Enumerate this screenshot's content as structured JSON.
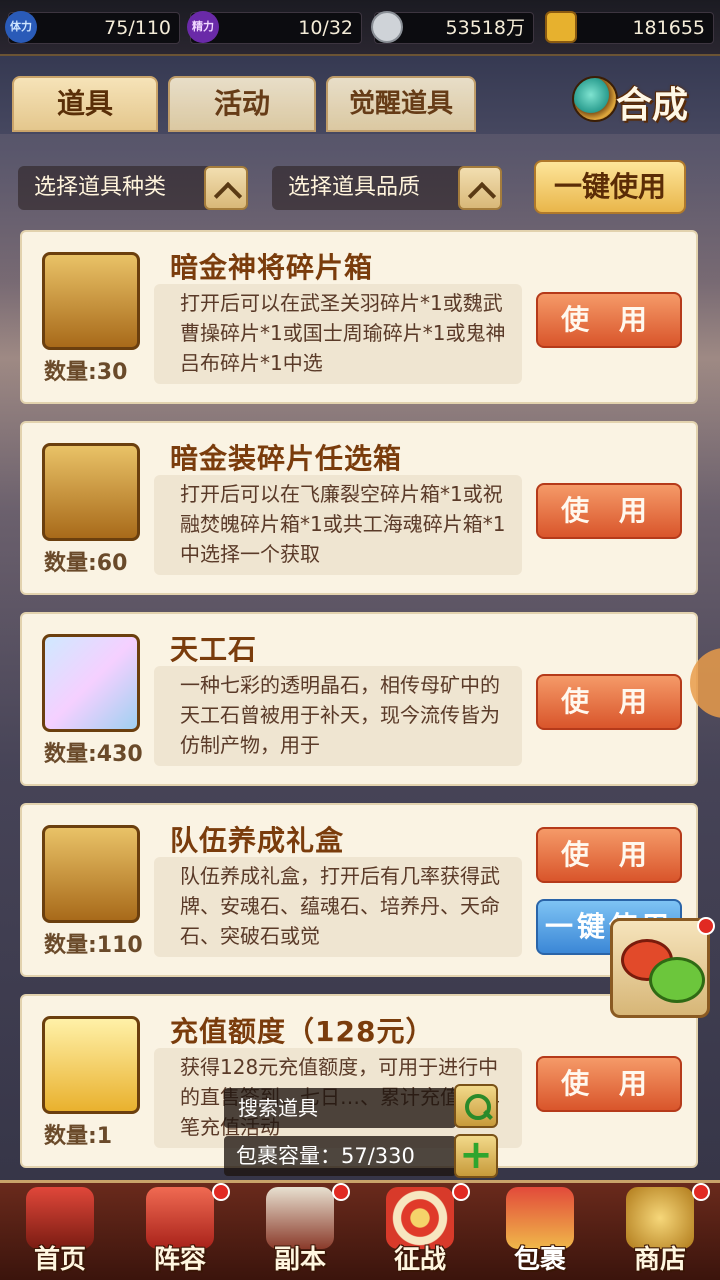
{
  "resources": {
    "stamina_icon": "体力",
    "stamina": "75/110",
    "energy_icon": "精力",
    "energy": "10/32",
    "silver": "53518万",
    "gold": "181655"
  },
  "tabs": [
    {
      "label": "道具"
    },
    {
      "label": "活动"
    },
    {
      "label": "觉醒道具"
    }
  ],
  "craft_label": "合成",
  "filters": {
    "type_label": "选择道具种类",
    "quality_label": "选择道具品质"
  },
  "use_all_label": "一键使用",
  "items": [
    {
      "title": "暗金神将碎片箱",
      "desc": "打开后可以在武圣关羽碎片*1或魏武曹操碎片*1或国士周瑜碎片*1或鬼神吕布碎片*1中选",
      "qty": "数量:30",
      "use_label": "使 用"
    },
    {
      "title": "暗金装碎片任选箱",
      "desc": "打开后可以在飞廉裂空碎片箱*1或祝融焚魄碎片箱*1或共工海魂碎片箱*1中选择一个获取",
      "qty": "数量:60",
      "use_label": "使 用"
    },
    {
      "title": "天工石",
      "desc": "一种七彩的透明晶石，相传母矿中的天工石曾被用于补天，现今流传皆为仿制产物，用于",
      "qty": "数量:430",
      "use_label": "使 用"
    },
    {
      "title": "队伍养成礼盒",
      "desc": "队伍养成礼盒，打开后有几率获得武牌、安魂石、蕴魂石、培养丹、天命石、突破石或觉",
      "qty": "数量:110",
      "use_label": "使 用",
      "use_all_label": "一键使用"
    },
    {
      "title": "充值额度（128元）",
      "desc": "获得128元充值额度，可用于进行中的直售签到、七日…、累计充值、单笔充值活动",
      "qty": "数量:1",
      "use_label": "使 用"
    }
  ],
  "search_label": "搜索道具",
  "capacity_label": "包裹容量：57/330",
  "nav": [
    {
      "label": "首页"
    },
    {
      "label": "阵容"
    },
    {
      "label": "副本"
    },
    {
      "label": "征战"
    },
    {
      "label": "包裹"
    },
    {
      "label": "商店"
    }
  ],
  "colors": {
    "accent_orange": "#d9552b",
    "accent_blue": "#3b87d6",
    "title_brown": "#7a3c0c",
    "card_bg": "#faf3e3"
  }
}
